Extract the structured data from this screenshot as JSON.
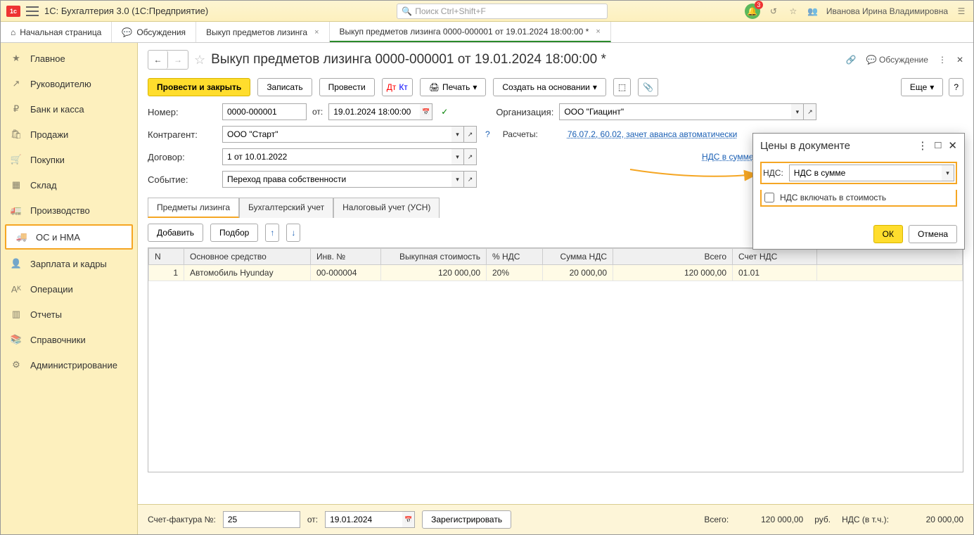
{
  "titlebar": {
    "app_title": "1С: Бухгалтерия 3.0  (1С:Предприятие)",
    "search_placeholder": "Поиск Ctrl+Shift+F",
    "bell_count": "3",
    "user": "Иванова Ирина Владимировна"
  },
  "tabs": [
    {
      "label": "Начальная страница",
      "closable": false
    },
    {
      "label": "Обсуждения",
      "closable": false
    },
    {
      "label": "Выкуп предметов лизинга",
      "closable": true
    },
    {
      "label": "Выкуп предметов лизинга 0000-000001 от 19.01.2024 18:00:00 *",
      "closable": true,
      "active": true
    }
  ],
  "sidebar": [
    {
      "icon": "★",
      "label": "Главное"
    },
    {
      "icon": "↗",
      "label": "Руководителю"
    },
    {
      "icon": "₽",
      "label": "Банк и касса"
    },
    {
      "icon": "🛍",
      "label": "Продажи"
    },
    {
      "icon": "🛒",
      "label": "Покупки"
    },
    {
      "icon": "▦",
      "label": "Склад"
    },
    {
      "icon": "🚛",
      "label": "Производство"
    },
    {
      "icon": "🚚",
      "label": "ОС и НМА",
      "selected": true
    },
    {
      "icon": "👤",
      "label": "Зарплата и кадры"
    },
    {
      "icon": "ᴬᴷ",
      "label": "Операции"
    },
    {
      "icon": "▥",
      "label": "Отчеты"
    },
    {
      "icon": "📚",
      "label": "Справочники"
    },
    {
      "icon": "⚙",
      "label": "Администрирование"
    }
  ],
  "doc": {
    "title": "Выкуп предметов лизинга 0000-000001 от 19.01.2024 18:00:00 *",
    "discuss": "Обсуждение"
  },
  "toolbar": {
    "post_close": "Провести и закрыть",
    "save": "Записать",
    "post": "Провести",
    "print": "Печать",
    "based_on": "Создать на основании",
    "more": "Еще",
    "help": "?"
  },
  "fields": {
    "number_lbl": "Номер:",
    "number": "0000-000001",
    "from_lbl": "от:",
    "date": "19.01.2024 18:00:00",
    "org_lbl": "Организация:",
    "org": "ООО \"Гиацинт\"",
    "contr_lbl": "Контрагент:",
    "contr": "ООО \"Старт\"",
    "calc_lbl": "Расчеты:",
    "calc_link": "76.07.2, 60.02, зачет аванса автоматически",
    "contract_lbl": "Договор:",
    "contract": "1 от 10.01.2022",
    "vat_link": "НДС в сумме",
    "event_lbl": "Событие:",
    "event": "Переход права собственности"
  },
  "subtabs": [
    "Предметы лизинга",
    "Бухгалтерский учет",
    "Налоговый учет (УСН)"
  ],
  "tbltools": {
    "add": "Добавить",
    "pick": "Подбор"
  },
  "table": {
    "headers": [
      "N",
      "Основное средство",
      "Инв. №",
      "Выкупная стоимость",
      "% НДС",
      "Сумма НДС",
      "Всего",
      "Счет НДС"
    ],
    "row": {
      "n": "1",
      "asset": "Автомобиль Hyunday",
      "inv": "00-000004",
      "cost": "120 000,00",
      "vat_pct": "20%",
      "vat_sum": "20 000,00",
      "total": "120 000,00",
      "acct": "01.01"
    }
  },
  "footer": {
    "sf_lbl": "Счет-фактура №:",
    "sf_no": "25",
    "sf_from": "от:",
    "sf_date": "19.01.2024",
    "reg": "Зарегистрировать",
    "total_lbl": "Всего:",
    "total": "120 000,00",
    "rub": "руб.",
    "vat_lbl": "НДС (в т.ч.):",
    "vat": "20 000,00"
  },
  "popup": {
    "title": "Цены в документе",
    "vat_lbl": "НДС:",
    "vat_val": "НДС в сумме",
    "chk_lbl": "НДС включать в стоимость",
    "ok": "ОК",
    "cancel": "Отмена"
  }
}
